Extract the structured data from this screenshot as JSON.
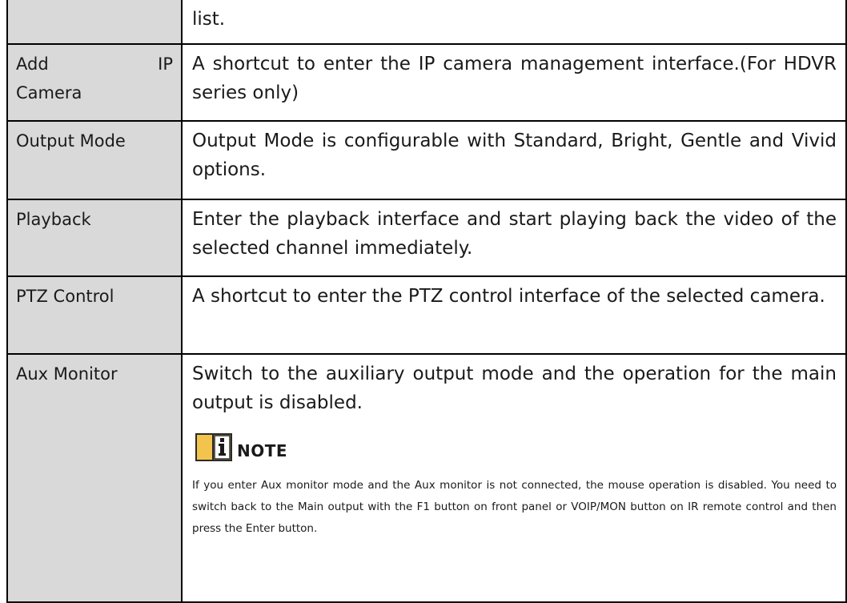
{
  "rows": [
    {
      "label": "",
      "description": "list."
    },
    {
      "label_parts": [
        "Add",
        "IP"
      ],
      "label_line2": "Camera",
      "description": "A shortcut to enter the IP camera management interface.(For HDVR series only)"
    },
    {
      "label": "Output Mode",
      "description": "Output Mode is configurable with Standard, Bright, Gentle and Vivid options."
    },
    {
      "label": "Playback",
      "description": "Enter the playback interface and start playing back the video of the selected channel immediately."
    },
    {
      "label": "PTZ Control",
      "description": "A shortcut to enter the PTZ control interface of the selected camera."
    },
    {
      "label": "Aux Monitor",
      "description": "Switch to the auxiliary output mode and the operation for the main output is disabled.",
      "note": {
        "icon": "info-book-icon",
        "title": "NOTE",
        "body": "If you enter Aux monitor mode and the Aux monitor is not connected, the mouse operation is disabled. You need to switch back to the Main output with the F1 button on front panel or VOIP/MON button on IR remote control and then press the Enter button."
      }
    }
  ],
  "colors": {
    "label_bg": "#d9d9d9",
    "border": "#000000",
    "note_icon_fill": "#f3c44d"
  }
}
